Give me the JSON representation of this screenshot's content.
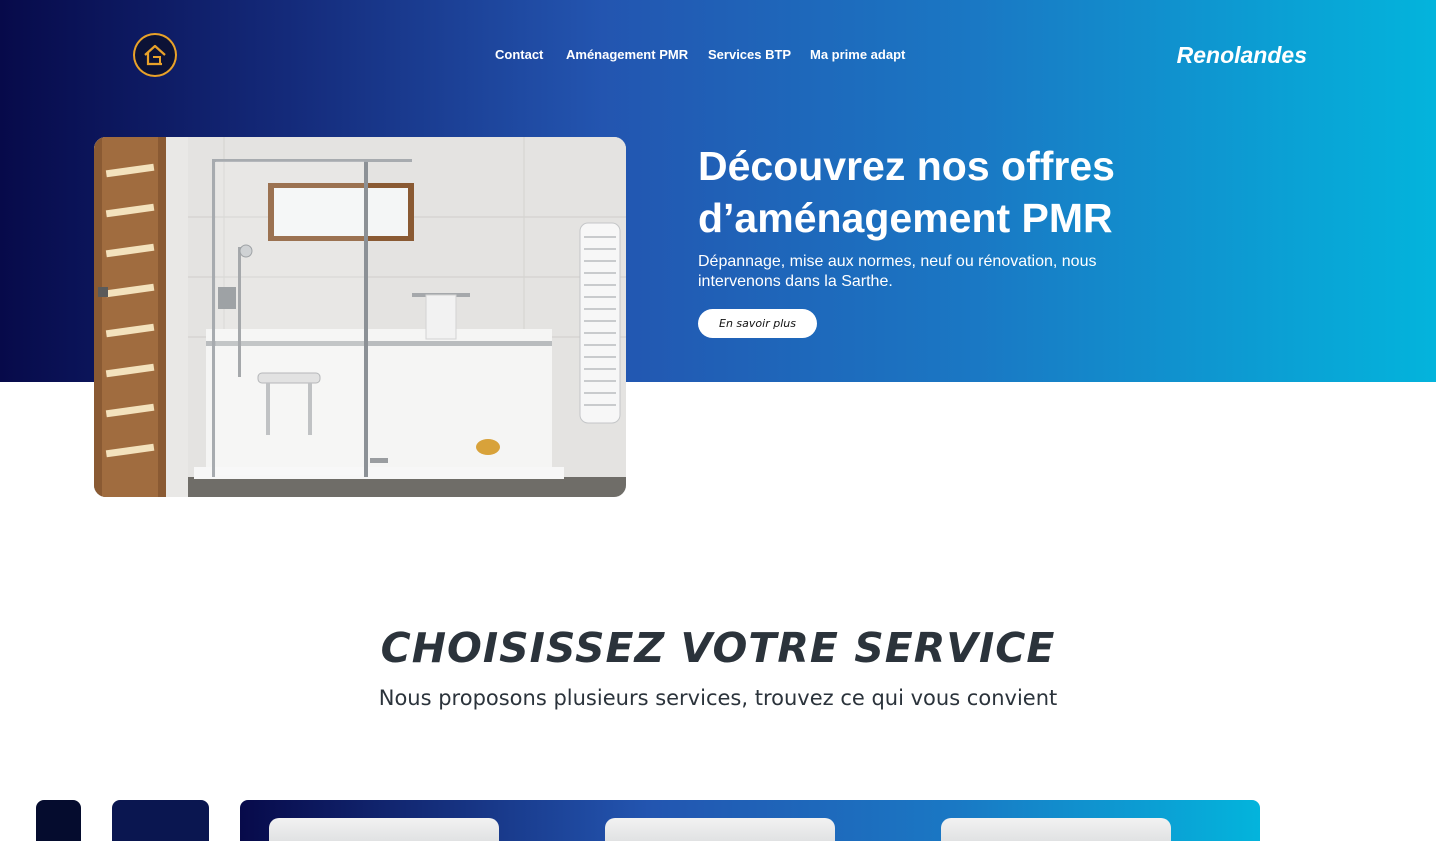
{
  "nav": {
    "logo_icon": "house-logo-icon",
    "links": [
      "Contact",
      "Aménagement PMR",
      "Services BTP",
      "Ma prime adapt"
    ],
    "brand": "Renolandes"
  },
  "hero": {
    "image_icon": "accessible-shower-photo",
    "title": "Découvrez nos offres d’aménagement PMR",
    "subtitle": "Dépannage, mise aux normes, neuf ou rénovation, nous intervenons dans la Sarthe.",
    "cta_label": "En savoir plus"
  },
  "services": {
    "title": "CHOISISSEZ VOTRE SERVICE",
    "subtitle": "Nous proposons plusieurs services, trouvez ce qui vous convient",
    "cards_visible": 3
  },
  "colors": {
    "gradient_start": "#070a4a",
    "gradient_mid": "#2355b0",
    "gradient_end": "#03b4dc",
    "logo_accent": "#e9a22a",
    "heading_text": "#2b333b"
  }
}
